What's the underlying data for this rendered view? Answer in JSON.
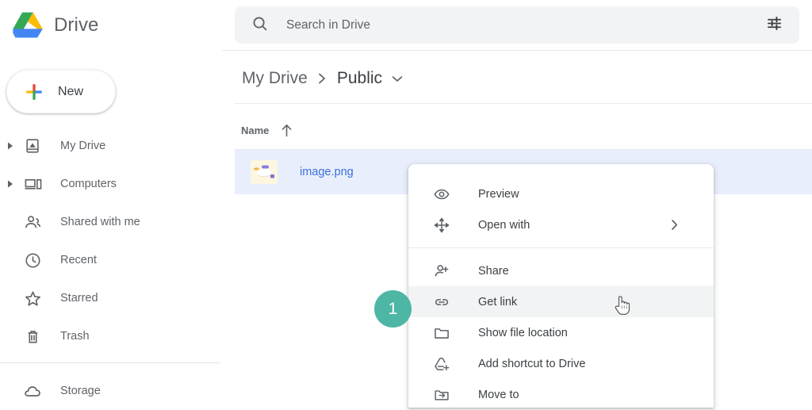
{
  "brand": {
    "title": "Drive",
    "logo_icon": "google-drive-logo"
  },
  "new_button": {
    "label": "New",
    "icon": "plus-icon"
  },
  "search": {
    "placeholder": "Search in Drive",
    "value": "",
    "search_icon": "search-icon",
    "filter_icon": "tune-filter-icon"
  },
  "sidebar": {
    "items": [
      {
        "label": "My Drive",
        "icon": "my-drive-icon",
        "expandable": true
      },
      {
        "label": "Computers",
        "icon": "computers-icon",
        "expandable": true
      },
      {
        "label": "Shared with me",
        "icon": "shared-with-me-icon",
        "expandable": false
      },
      {
        "label": "Recent",
        "icon": "clock-icon",
        "expandable": false
      },
      {
        "label": "Starred",
        "icon": "star-icon",
        "expandable": false
      },
      {
        "label": "Trash",
        "icon": "trash-icon",
        "expandable": false
      },
      {
        "label": "Storage",
        "icon": "cloud-icon",
        "expandable": false
      }
    ]
  },
  "breadcrumb": {
    "root": "My Drive",
    "separator_icon": "chevron-right-icon",
    "current": "Public",
    "caret_icon": "chevron-down-icon"
  },
  "file_list": {
    "column_header": "Name",
    "sort_icon": "arrow-up-icon",
    "rows": [
      {
        "name": "image.png",
        "icon": "image-thumbnail",
        "selected": true
      }
    ]
  },
  "context_menu": {
    "items": [
      {
        "label": "Preview",
        "icon": "eye-icon",
        "highlighted": false,
        "submenu": false
      },
      {
        "label": "Open with",
        "icon": "open-with-move-icon",
        "highlighted": false,
        "submenu": true
      },
      {
        "label": "Share",
        "icon": "person-add-icon",
        "highlighted": false,
        "submenu": false
      },
      {
        "label": "Get link",
        "icon": "link-icon",
        "highlighted": true,
        "submenu": false
      },
      {
        "label": "Show file location",
        "icon": "folder-icon",
        "highlighted": false,
        "submenu": false
      },
      {
        "label": "Add shortcut to Drive",
        "icon": "drive-add-icon",
        "highlighted": false,
        "submenu": false
      },
      {
        "label": "Move to",
        "icon": "move-to-folder-icon",
        "highlighted": false,
        "submenu": false
      }
    ],
    "submenu_icon": "chevron-right-icon"
  },
  "annotation_badge": {
    "number": "1",
    "color": "#4db6a4"
  },
  "cursor": {
    "icon": "pointing-hand-cursor"
  },
  "colors": {
    "selected_row": "#e8eefc",
    "file_link": "#3c6fdd",
    "search_bg": "#f1f3f4",
    "text_primary": "#3c4043",
    "text_secondary": "#5f6368",
    "badge": "#4db6a4",
    "menu_highlight": "#f1f3f4"
  }
}
